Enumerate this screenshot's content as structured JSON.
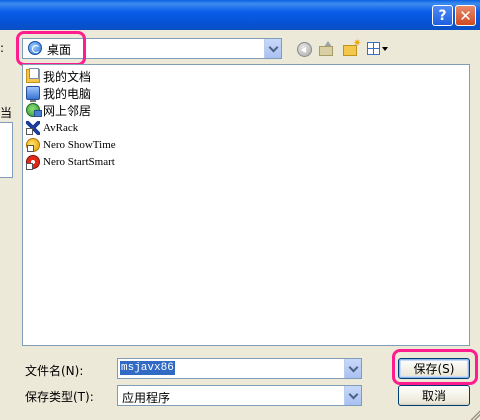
{
  "window": {
    "help_symbol": "?",
    "close_symbol": "✕"
  },
  "left": {
    "savein_label_cut": ":",
    "places_label_cut": "当"
  },
  "save_in": {
    "value": "桌面",
    "icon": "desktop-icon"
  },
  "toolbar": {
    "icons": [
      "back-icon",
      "up-folder-icon",
      "new-folder-icon",
      "views-menu-icon"
    ]
  },
  "files": [
    {
      "name": "我的文档",
      "icon": "my-documents-icon"
    },
    {
      "name": "我的电脑",
      "icon": "my-computer-icon"
    },
    {
      "name": "网上邻居",
      "icon": "network-places-icon"
    },
    {
      "name": "AvRack",
      "icon": "avrack-shortcut-icon"
    },
    {
      "name": "Nero ShowTime",
      "icon": "nero-showtime-shortcut-icon"
    },
    {
      "name": "Nero StartSmart",
      "icon": "nero-startsmart-shortcut-icon"
    }
  ],
  "filename": {
    "label": "文件名(N):",
    "value": "msjavx86"
  },
  "filetype": {
    "label": "保存类型(T):",
    "value": "应用程序"
  },
  "buttons": {
    "save": "保存(S)",
    "cancel": "取消"
  },
  "colors": {
    "highlight": "#ff1d8e",
    "titlebar": "#0a5be8",
    "selection": "#316ac5"
  }
}
